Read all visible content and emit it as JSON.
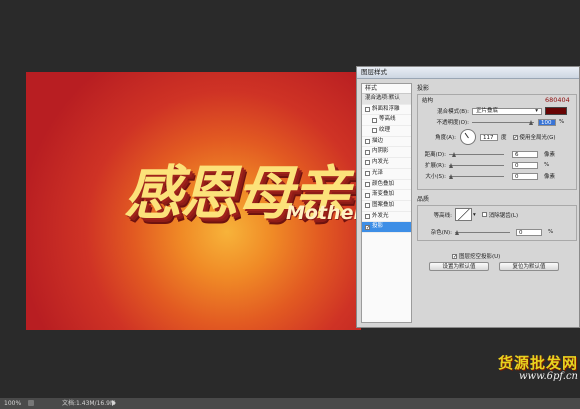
{
  "canvas": {
    "title_text": "感恩母亲",
    "subtitle_text": "Mother"
  },
  "dialog": {
    "title": "图层样式",
    "styles_header": "样式",
    "styles": [
      {
        "label": "混合选项:默认",
        "checkbox": false,
        "checked": false,
        "indent": false,
        "state": "blend"
      },
      {
        "label": "斜面和浮雕",
        "checkbox": true,
        "checked": false,
        "indent": false,
        "state": ""
      },
      {
        "label": "等高线",
        "checkbox": true,
        "checked": false,
        "indent": true,
        "state": ""
      },
      {
        "label": "纹理",
        "checkbox": true,
        "checked": false,
        "indent": true,
        "state": ""
      },
      {
        "label": "描边",
        "checkbox": true,
        "checked": false,
        "indent": false,
        "state": ""
      },
      {
        "label": "内阴影",
        "checkbox": true,
        "checked": false,
        "indent": false,
        "state": ""
      },
      {
        "label": "内发光",
        "checkbox": true,
        "checked": false,
        "indent": false,
        "state": ""
      },
      {
        "label": "光泽",
        "checkbox": true,
        "checked": false,
        "indent": false,
        "state": ""
      },
      {
        "label": "颜色叠加",
        "checkbox": true,
        "checked": false,
        "indent": false,
        "state": ""
      },
      {
        "label": "渐变叠加",
        "checkbox": true,
        "checked": false,
        "indent": false,
        "state": ""
      },
      {
        "label": "图案叠加",
        "checkbox": true,
        "checked": false,
        "indent": false,
        "state": ""
      },
      {
        "label": "外发光",
        "checkbox": true,
        "checked": false,
        "indent": false,
        "state": ""
      },
      {
        "label": "投影",
        "checkbox": true,
        "checked": true,
        "indent": false,
        "state": "active"
      }
    ],
    "section_title": "投影",
    "structure_label": "结构",
    "color_hex": "680404",
    "blend_mode_label": "混合模式(B):",
    "blend_mode_value": "正片叠底",
    "opacity_label": "不透明度(O):",
    "opacity_value": "100",
    "opacity_fraction": 1.0,
    "percent_unit": "%",
    "angle_label": "角度(A):",
    "angle_value": "117",
    "angle_unit": "度",
    "global_light_label": "使用全局光(G)",
    "global_light_checked": true,
    "distance_label": "距离(D):",
    "distance_value": "6",
    "distance_fraction": 0.05,
    "spread_label": "扩展(R):",
    "spread_value": "0",
    "spread_fraction": 0.0,
    "size_label": "大小(S):",
    "size_value": "0",
    "size_fraction": 0.0,
    "pixel_unit": "像素",
    "quality_label": "品质",
    "contour_label": "等高线:",
    "antialias_label": "消除锯齿(L)",
    "antialias_checked": false,
    "noise_label": "杂色(N):",
    "noise_value": "0",
    "noise_fraction": 0.0,
    "knockout_label": "图层挖空投影(U)",
    "knockout_checked": true,
    "default_btn": "设置为默认值",
    "reset_btn": "复位为默认值"
  },
  "status": {
    "zoom": "100%",
    "doc_info": "文档:1.43M/16.9M"
  },
  "watermark": {
    "line1": "货源批发网",
    "line2": "www.6pf.cn"
  },
  "colors": {
    "shadow_color": "#680404",
    "selection_blue": "#3d8ee6"
  }
}
